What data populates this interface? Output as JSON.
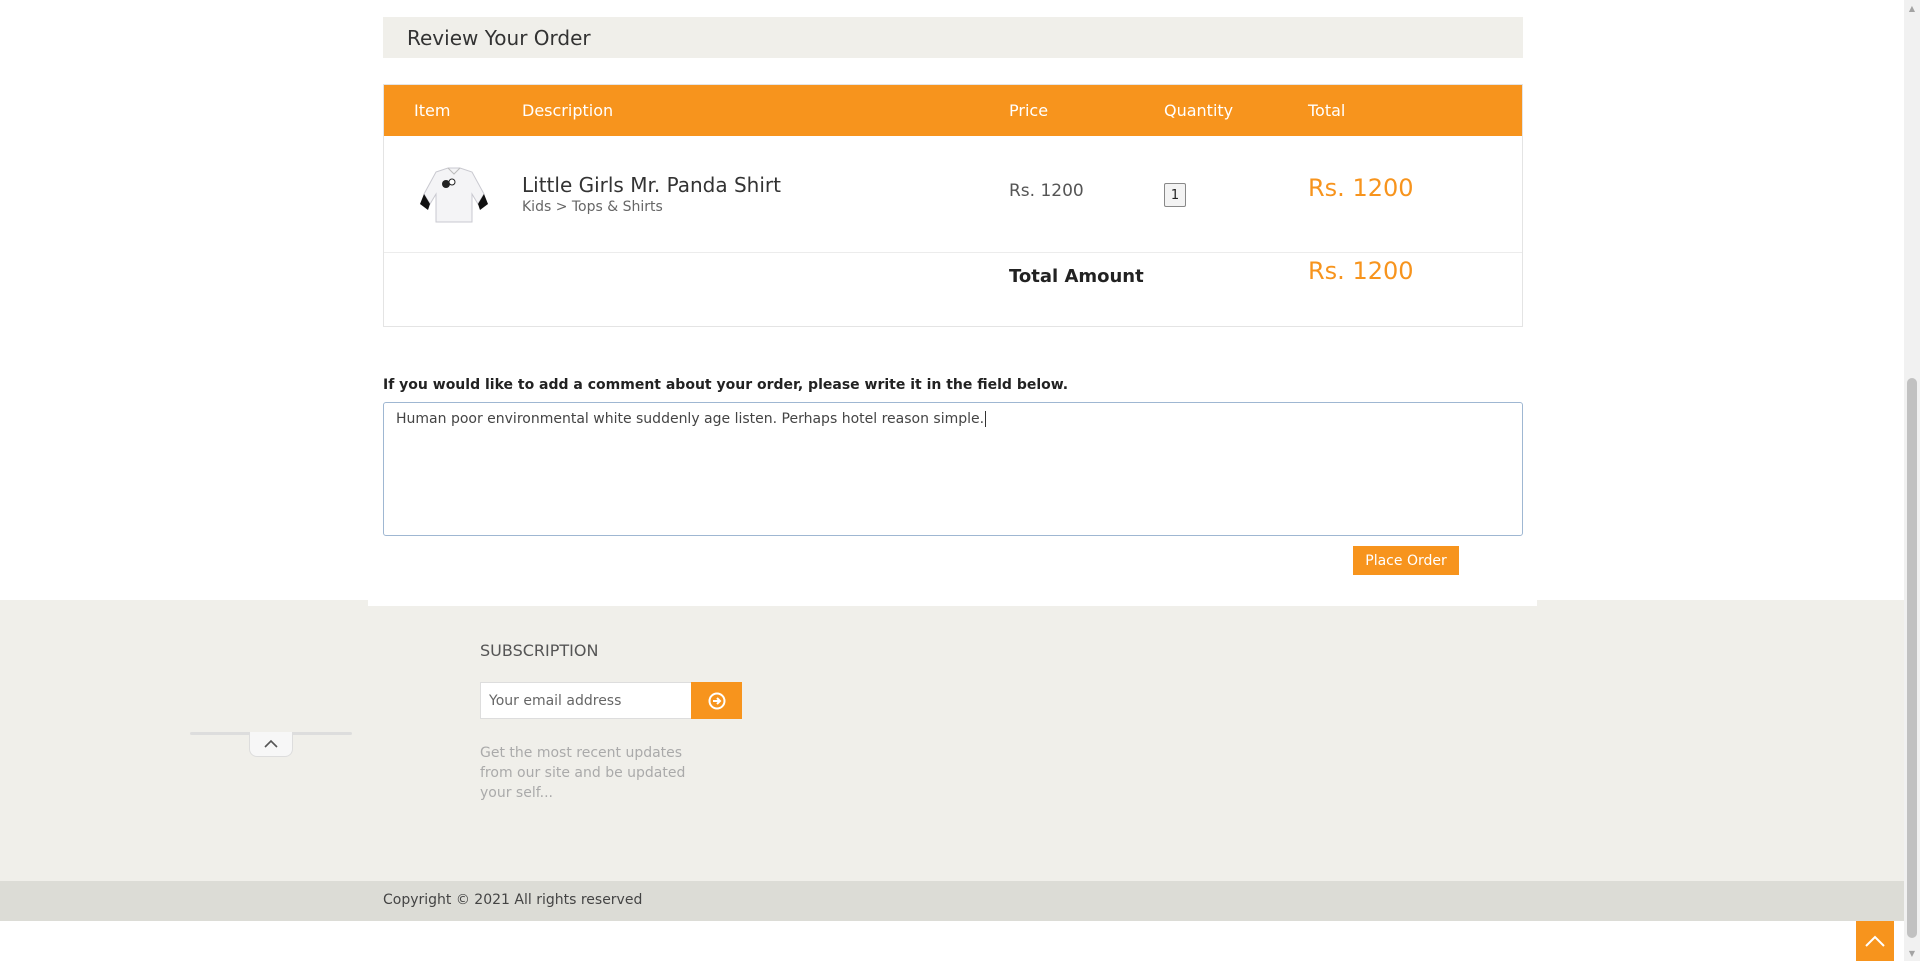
{
  "review": {
    "title": "Review Your Order"
  },
  "table": {
    "headers": [
      "Item",
      "Description",
      "Price",
      "Quantity",
      "Total"
    ],
    "item": {
      "name": "Little Girls Mr. Panda Shirt",
      "category": "Kids > Tops & Shirts",
      "price": "Rs. 1200",
      "quantity": "1",
      "total": "Rs. 1200"
    },
    "total_label": "Total Amount",
    "total_value": "Rs. 1200"
  },
  "comment": {
    "label": "If you would like to add a comment about your order, please write it in the field below.",
    "value": "Human poor environmental white suddenly age listen. Perhaps hotel reason simple."
  },
  "place_order_label": "Place Order",
  "footer": {
    "subscription_title": "SUBSCRIPTION",
    "email_placeholder": "Your email address",
    "subscription_text": "Get the most recent updates from our site and be updated your self...",
    "copyright": "Copyright © 2021 All rights reserved"
  },
  "colors": {
    "accent": "#f7941d",
    "panel": "#f0efea",
    "copyright_bar": "#dcdcd6"
  }
}
